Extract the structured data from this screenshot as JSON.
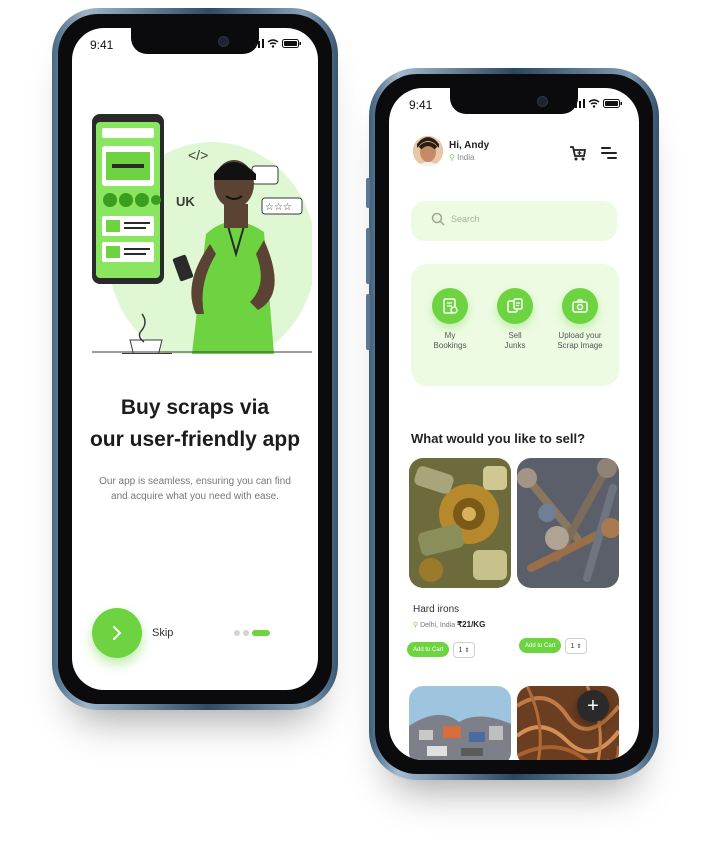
{
  "onboarding": {
    "status_time": "9:41",
    "illustration_tag": "UK",
    "title_line1": "Buy scraps via",
    "title_line2": "our user-friendly app",
    "subtitle": "Our app is seamless, ensuring you can find and acquire what you need with ease.",
    "skip_label": "Skip",
    "next_icon": "chevron-right-icon",
    "page_dots": 3,
    "active_dot": 3
  },
  "home": {
    "status_time": "9:41",
    "greeting": "Hi, Andy",
    "location": "India",
    "search_placeholder": "Search",
    "quick_actions": [
      {
        "label_line1": "My",
        "label_line2": "Bookings",
        "icon": "booking-icon"
      },
      {
        "label_line1": "Sell",
        "label_line2": "Junks",
        "icon": "sell-icon"
      },
      {
        "label_line1": "Upload your",
        "label_line2": "Scrap Image",
        "icon": "camera-upload-icon"
      }
    ],
    "section_title": "What would you like to sell?",
    "items": [
      {
        "name": "Hard irons",
        "location": "Delhi, India",
        "price": "₹21/KG",
        "add_label": "Add to Cart",
        "qty": "1"
      },
      {
        "add_label": "Add to Cart",
        "qty": "1"
      }
    ],
    "fab_label": "+"
  },
  "colors": {
    "accent": "#6ed340",
    "soft_green": "#ecfbe2",
    "dark": "#2a2a2a"
  }
}
